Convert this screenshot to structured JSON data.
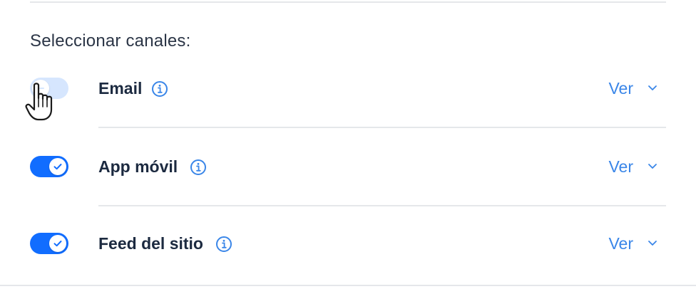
{
  "section": {
    "title": "Seleccionar canales:"
  },
  "channels": [
    {
      "label": "Email",
      "enabled": false,
      "view_label": "Ver"
    },
    {
      "label": "App móvil",
      "enabled": true,
      "view_label": "Ver"
    },
    {
      "label": "Feed del sitio",
      "enabled": true,
      "view_label": "Ver"
    }
  ],
  "icons": {
    "info": "info-icon",
    "expand": "chevron-down-icon",
    "toggle_check": "check-icon",
    "cursor": "hand-pointer-icon"
  },
  "colors": {
    "toggle_on": "#116dff",
    "toggle_off": "#d6e6fe",
    "link": "#3a86e8",
    "text": "#1c2a40",
    "divider": "#e5e7ea"
  }
}
